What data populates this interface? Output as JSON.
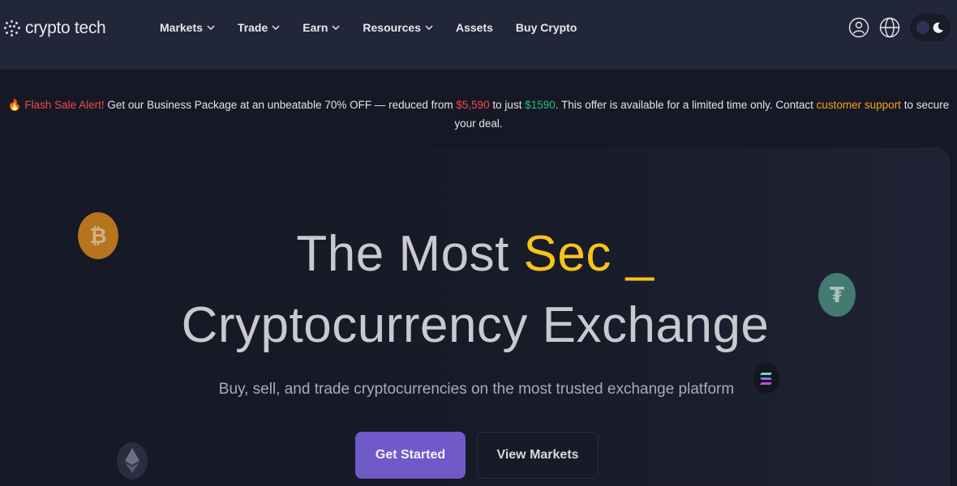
{
  "brand": {
    "name": "crypto tech"
  },
  "nav": {
    "items": [
      {
        "label": "Markets",
        "dropdown": true
      },
      {
        "label": "Trade",
        "dropdown": true
      },
      {
        "label": "Earn",
        "dropdown": true
      },
      {
        "label": "Resources",
        "dropdown": true
      },
      {
        "label": "Assets",
        "dropdown": false
      },
      {
        "label": "Buy Crypto",
        "dropdown": false
      }
    ]
  },
  "header_icons": [
    "user-icon",
    "globe-icon",
    "theme-toggle"
  ],
  "promo": {
    "icon": "🔥",
    "alert": "Flash Sale Alert!",
    "text_1": " Get our Business Package at an unbeatable 70% OFF — reduced from ",
    "old_price": "$5,590",
    "text_2": " to just ",
    "new_price": "$1590",
    "text_3": ". This offer is available for a limited time only. Contact ",
    "link": "customer support",
    "text_4": " to secure your deal."
  },
  "hero": {
    "line1_prefix": "The Most ",
    "line1_accent": "Sec _",
    "line2": "Cryptocurrency Exchange",
    "subtitle": "Buy, sell, and trade cryptocurrencies on the most trusted exchange platform",
    "primary_button": "Get Started",
    "secondary_button": "View Markets"
  },
  "colors": {
    "background": "#161925",
    "header": "#222639",
    "accent": "#f8c31a",
    "primary_button": "#6f5ac8",
    "sale_red": "#ef4b4b",
    "price_green": "#1fc47a",
    "link_orange": "#f7a21b"
  },
  "coins": [
    "bitcoin-icon",
    "tether-icon",
    "solana-icon",
    "ethereum-icon"
  ]
}
